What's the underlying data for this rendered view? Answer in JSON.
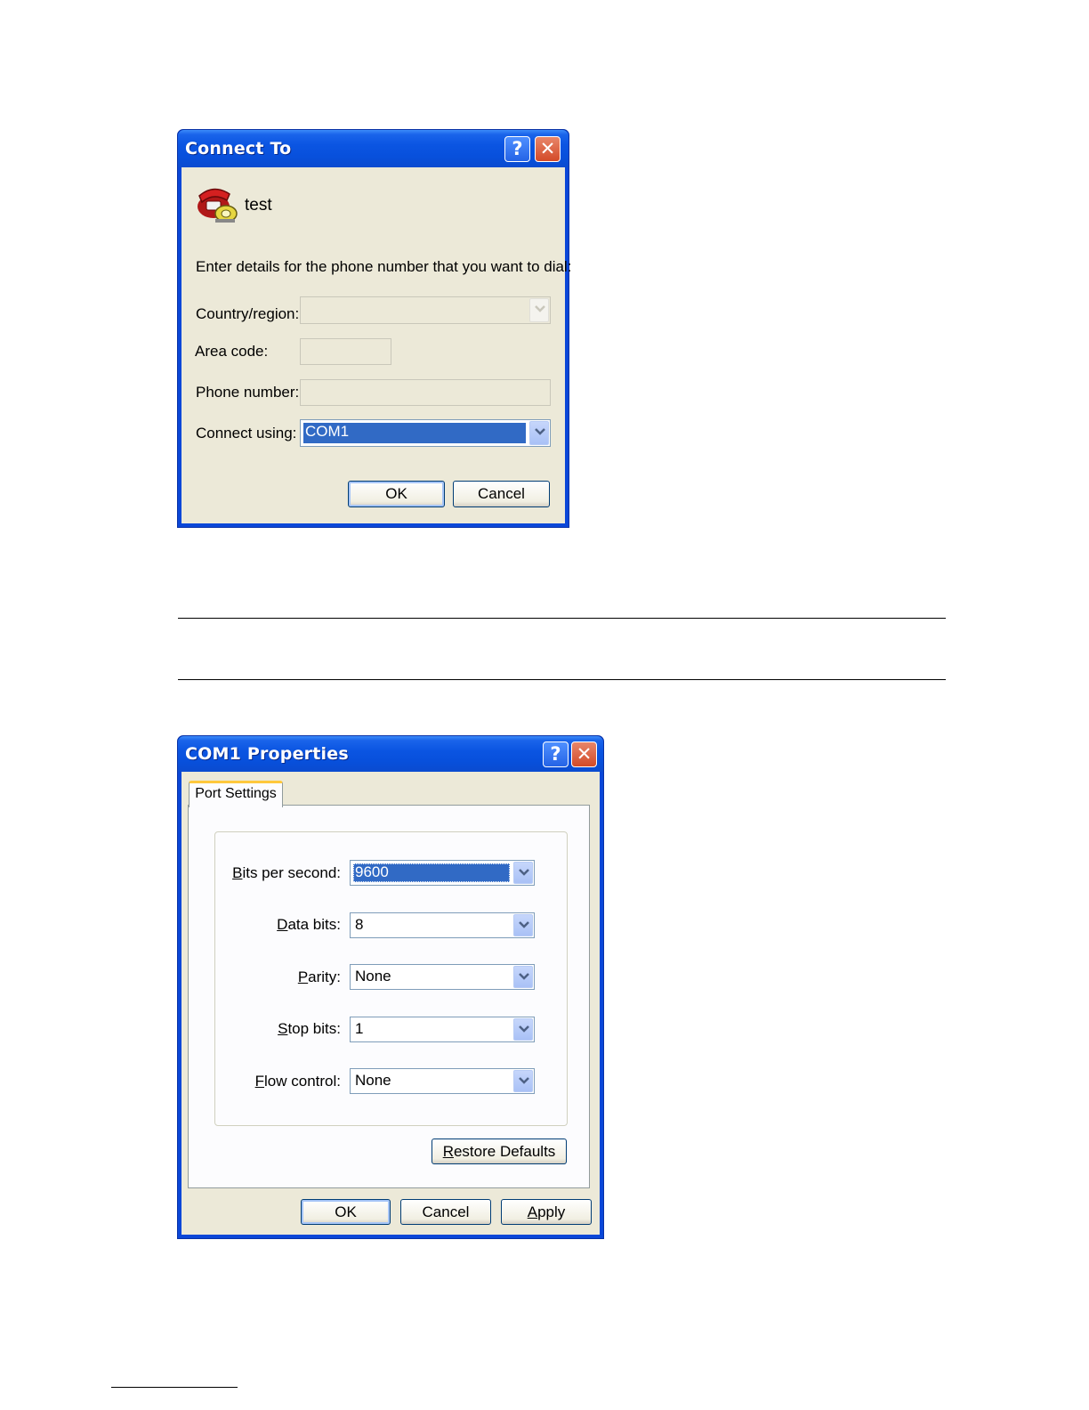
{
  "connect_dialog": {
    "title": "Connect To",
    "connection_name": "test",
    "instructions": "Enter details for the phone number that you want to dial:",
    "country_label": "Country/region:",
    "country_value": "",
    "area_code_label": "Area code:",
    "area_code_value": "",
    "phone_label": "Phone number:",
    "phone_value": "",
    "connect_using_label": "Connect using:",
    "connect_using_value": "COM1",
    "ok_label": "OK",
    "cancel_label": "Cancel",
    "help_glyph": "?",
    "close_glyph": "✕",
    "icon": "phone-icon"
  },
  "properties_dialog": {
    "title": "COM1 Properties",
    "tab_label": "Port Settings",
    "bits_per_second": {
      "label_accel": "B",
      "label_rest": "its per second:",
      "value": "9600"
    },
    "data_bits": {
      "label_accel": "D",
      "label_rest": "ata bits:",
      "value": "8"
    },
    "parity": {
      "label_accel": "P",
      "label_rest": "arity:",
      "value": "None"
    },
    "stop_bits": {
      "label_accel": "S",
      "label_rest": "top bits:",
      "value": "1"
    },
    "flow_control": {
      "label_accel": "F",
      "label_rest": "low control:",
      "value": "None"
    },
    "restore_accel": "R",
    "restore_rest": "estore Defaults",
    "ok_label": "OK",
    "cancel_label": "Cancel",
    "apply_accel": "A",
    "apply_rest": "pply",
    "help_glyph": "?",
    "close_glyph": "✕"
  },
  "colors": {
    "title_bar": "#0a4bd0",
    "dialog_face": "#ece9d8",
    "selection": "#316ac5"
  }
}
